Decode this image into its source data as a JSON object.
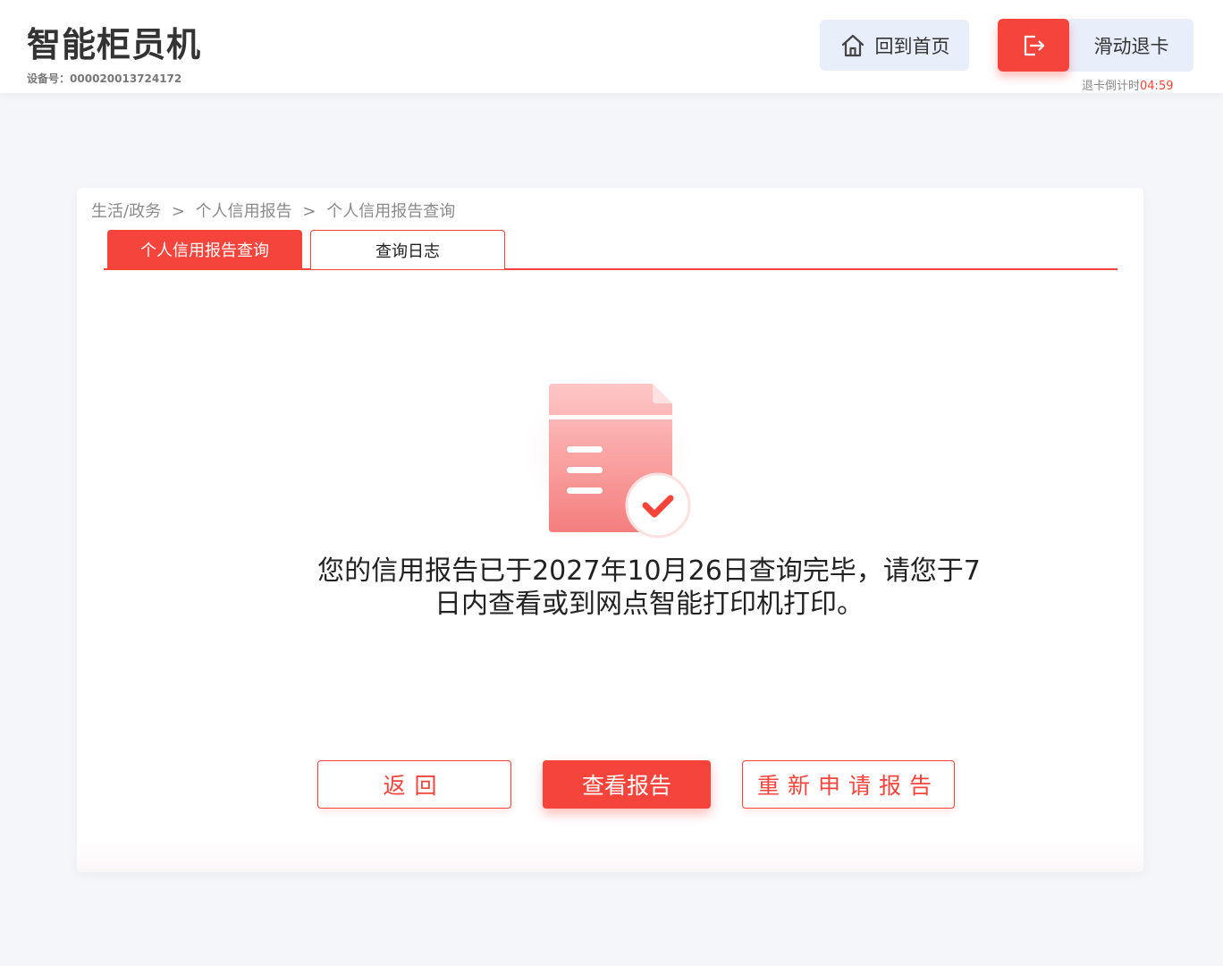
{
  "header": {
    "app_title": "智能柜员机",
    "device_label": "设备号：",
    "device_id": "000020013724172",
    "home_button_label": "回到首页",
    "exit_button_label": "滑动退卡",
    "countdown_label": "退卡倒计时",
    "countdown_time": "04:59"
  },
  "breadcrumb": {
    "items": [
      "生活/政务",
      "个人信用报告",
      "个人信用报告查询"
    ],
    "separator": ">"
  },
  "tabs": [
    {
      "label": "个人信用报告查询",
      "active": true
    },
    {
      "label": "查询日志",
      "active": false
    }
  ],
  "result": {
    "message": "您的信用报告已于2027年10月26日查询完毕，请您于7日内查看或到网点智能打印机打印。"
  },
  "actions": {
    "back_label": "返回",
    "view_report_label": "查看报告",
    "reapply_label": "重新申请报告"
  },
  "colors": {
    "accent": "#f4443c",
    "header_button_bg": "#e9eefb",
    "page_bg": "#f5f6fa"
  },
  "icons": {
    "home": "home-icon",
    "exit": "exit-card-icon",
    "success": "document-check-icon"
  }
}
